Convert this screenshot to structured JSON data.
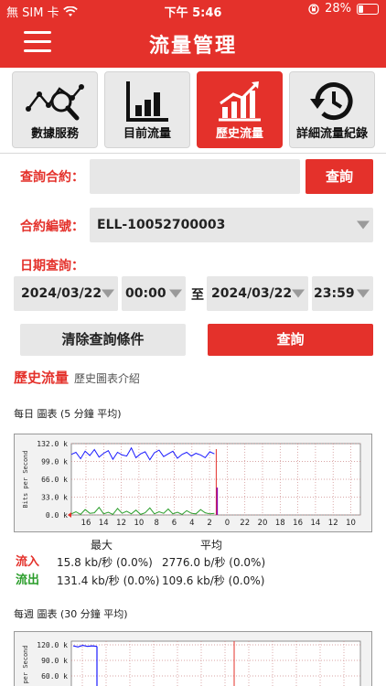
{
  "status": {
    "carrier": "無 SIM 卡",
    "time": "下午 5:46",
    "battery": "28%",
    "battery_level": 0.28
  },
  "header": {
    "title": "流量管理"
  },
  "tabs": [
    {
      "label": "數據服務",
      "icon": "magnifier-graph-icon"
    },
    {
      "label": "目前流量",
      "icon": "bar-chart-icon"
    },
    {
      "label": "歷史流量",
      "icon": "rising-chart-icon"
    },
    {
      "label": "詳細流量紀錄",
      "icon": "history-clock-icon"
    }
  ],
  "query": {
    "contract_label": "查詢合約：",
    "contract_value": "",
    "query_button": "查詢",
    "number_label": "合約編號：",
    "number_value": "ELL-10052700003",
    "date_label": "日期查詢：",
    "start_date": "2024/03/22",
    "start_time": "00:00",
    "to": "至",
    "end_date": "2024/03/22",
    "end_time": "23:59",
    "clear_button": "清除查詢條件",
    "submit_button": "查詢"
  },
  "history": {
    "title": "歷史流量",
    "intro": "歷史圖表介紹"
  },
  "daily": {
    "caption": "每日 圖表 (5 分鐘 平均)",
    "max_label": "最大",
    "avg_label": "平均",
    "in_label": "流入",
    "out_label": "流出",
    "in_max": "15.8 kb/秒 (0.0%)",
    "in_avg": "2776.0 b/秒 (0.0%)",
    "out_max": "131.4 kb/秒 (0.0%)",
    "out_avg": "109.6 kb/秒 (0.0%)"
  },
  "weekly": {
    "caption": "每週 圖表 (30 分鐘 平均)"
  },
  "colors": {
    "accent": "#e4312b",
    "in": "#2a9d2a",
    "out": "#1a1aff"
  },
  "chart_data": [
    {
      "type": "line",
      "yaxis_label": "Bits per Second",
      "y_ticks": [
        "0.0 k",
        "33.0 k",
        "66.0 k",
        "99.0 k",
        "132.0 k"
      ],
      "ylim": [
        0,
        132
      ],
      "x_ticks": [
        "16",
        "14",
        "12",
        "10",
        "8",
        "6",
        "4",
        "2",
        "0",
        "22",
        "20",
        "18",
        "16",
        "14",
        "12",
        "10"
      ],
      "series": [
        {
          "name": "out",
          "values": [
            112,
            116,
            104,
            118,
            110,
            121,
            107,
            114,
            119,
            103,
            116,
            111,
            109,
            124,
            106,
            113,
            117,
            102,
            115,
            120,
            108,
            113,
            118,
            105,
            112,
            116,
            109,
            114,
            111,
            106,
            117,
            113
          ]
        },
        {
          "name": "in",
          "values": [
            2,
            6,
            1,
            10,
            3,
            4,
            14,
            2,
            5,
            1,
            12,
            3,
            7,
            2,
            9,
            1,
            4,
            13,
            2,
            6,
            3,
            11,
            2,
            5,
            1,
            8,
            3,
            2,
            10,
            4,
            2,
            3
          ]
        }
      ]
    },
    {
      "type": "line",
      "y_ticks": [
        "60.0 k",
        "90.0 k",
        "120.0 k"
      ],
      "ylim": [
        0,
        120
      ],
      "series": [
        {
          "name": "out",
          "values": [
            118,
            116,
            119,
            117,
            118,
            117
          ]
        }
      ]
    }
  ]
}
